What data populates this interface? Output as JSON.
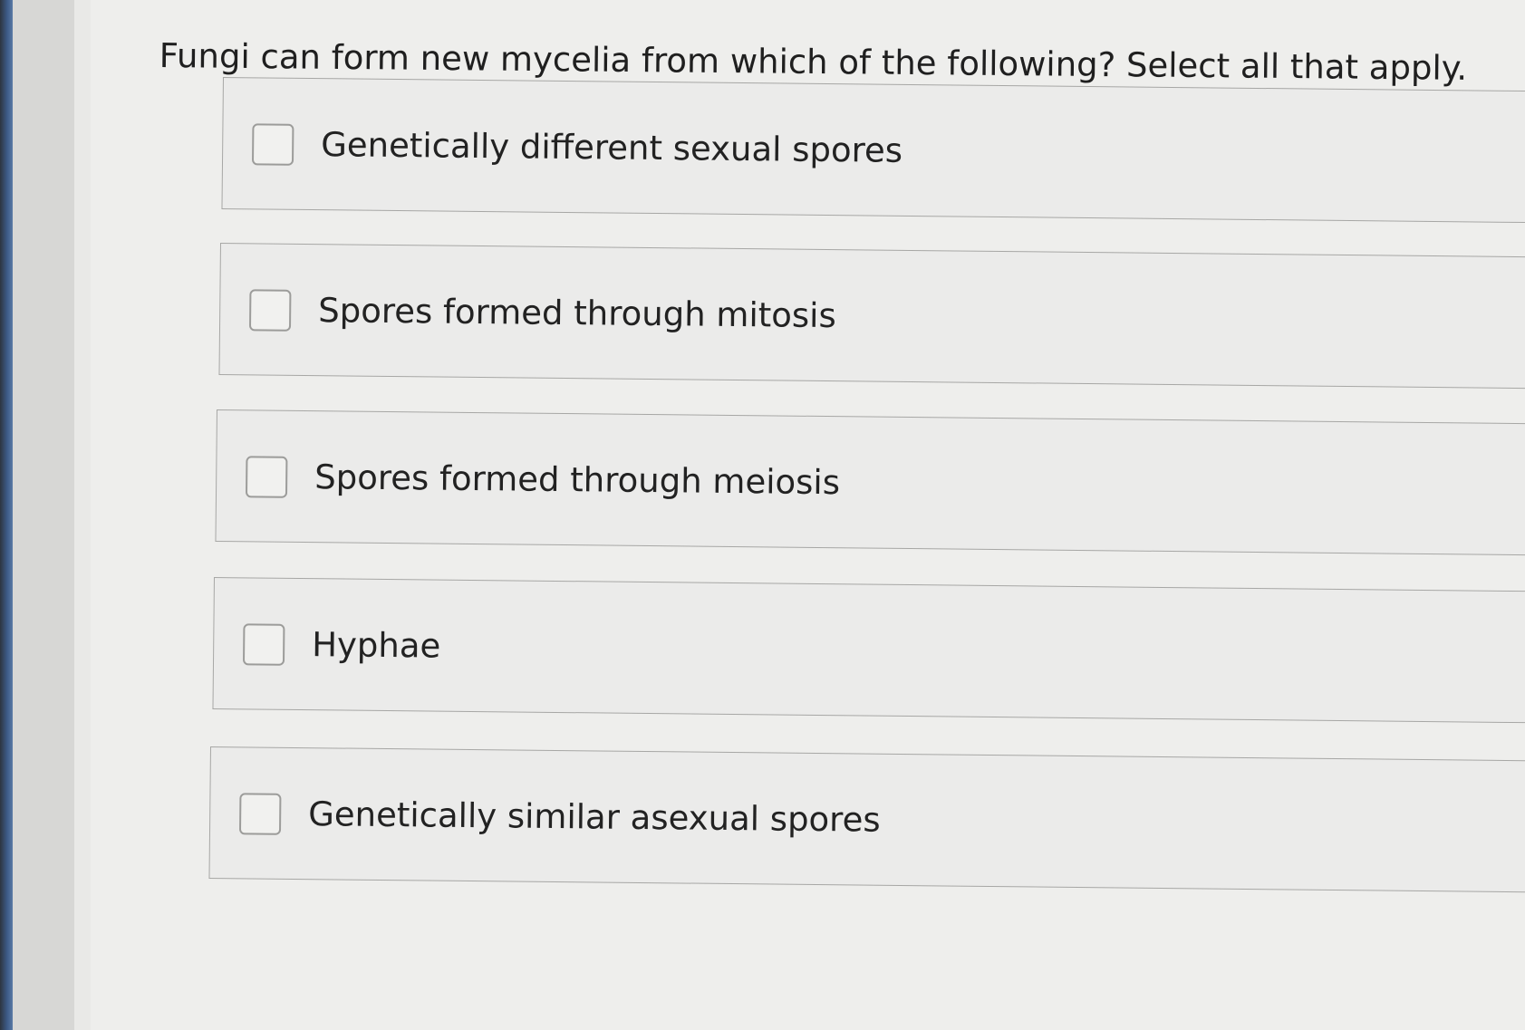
{
  "question": {
    "text": "Fungi can form new mycelia from which of the following? Select all that apply."
  },
  "options": [
    {
      "label": "Genetically different sexual spores",
      "checked": false
    },
    {
      "label": "Spores formed through mitosis",
      "checked": false
    },
    {
      "label": "Spores formed through meiosis",
      "checked": false
    },
    {
      "label": "Hyphae",
      "checked": false
    },
    {
      "label": "Genetically similar asexual spores",
      "checked": false
    }
  ]
}
